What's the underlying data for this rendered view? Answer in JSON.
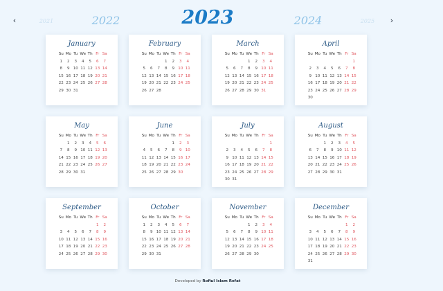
{
  "nav": {
    "prev_glyph": "‹",
    "next_glyph": "›",
    "prev_icon": "chevron-left-icon",
    "next_icon": "chevron-right-icon"
  },
  "years": {
    "far_prev": "2021",
    "prev": "2022",
    "current": "2023",
    "next": "2024",
    "far_next": "2025"
  },
  "weekdays": [
    "Su",
    "Mo",
    "Tu",
    "We",
    "Th",
    "Fr",
    "Sa"
  ],
  "colors": {
    "background": "#eef6fd",
    "accent": "#1b7bc6",
    "weekend": "#e0545c",
    "month_title": "#2c5a86"
  },
  "months": [
    {
      "name": "January",
      "start": 0,
      "days": 31
    },
    {
      "name": "February",
      "start": 3,
      "days": 28
    },
    {
      "name": "March",
      "start": 3,
      "days": 31
    },
    {
      "name": "April",
      "start": 6,
      "days": 30
    },
    {
      "name": "May",
      "start": 1,
      "days": 31
    },
    {
      "name": "June",
      "start": 4,
      "days": 30
    },
    {
      "name": "July",
      "start": 6,
      "days": 31
    },
    {
      "name": "August",
      "start": 2,
      "days": 31
    },
    {
      "name": "September",
      "start": 5,
      "days": 30
    },
    {
      "name": "October",
      "start": 0,
      "days": 31
    },
    {
      "name": "November",
      "start": 3,
      "days": 30
    },
    {
      "name": "December",
      "start": 5,
      "days": 31
    }
  ],
  "footer": {
    "prefix": "Developed by ",
    "author": "Rofiul Islam Refat"
  }
}
